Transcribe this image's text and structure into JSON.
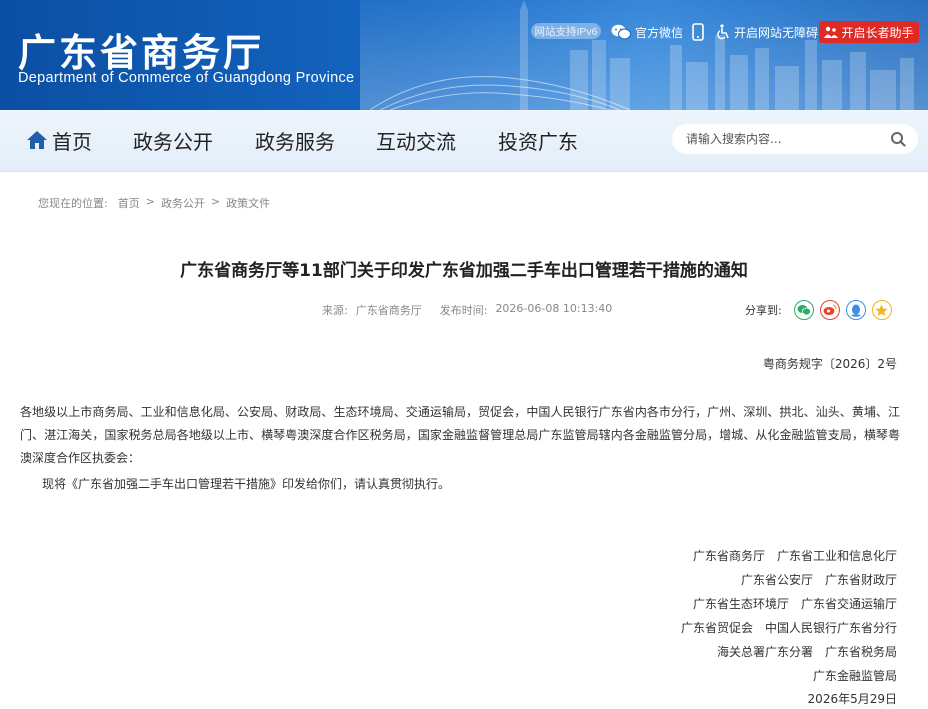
{
  "header": {
    "title": "广东省商务厅",
    "subtitle": "Department of Commerce of Guangdong Province",
    "ipv6": "网站支持IPv6",
    "wechat": "官方微信",
    "accessibility": "开启网站无障碍",
    "elder": "开启长者助手"
  },
  "nav": {
    "items": [
      "首页",
      "政务公开",
      "政务服务",
      "互动交流",
      "投资广东"
    ],
    "search_placeholder": "请输入搜索内容..."
  },
  "breadcrumb": {
    "prefix": "您现在的位置:",
    "items": [
      "首页",
      "政务公开",
      "政策文件"
    ],
    "separator": ">"
  },
  "article": {
    "title": "广东省商务厅等11部门关于印发广东省加强二手车出口管理若干措施的通知",
    "source_label": "来源:",
    "source": "广东省商务厅",
    "time_label": "发布时间:",
    "time": "2026-06-08 10:13:40",
    "share_label": "分享到:",
    "doc_number": "粤商务规字〔2026〕2号",
    "recipients": "各地级以上市商务局、工业和信息化局、公安局、财政局、生态环境局、交通运输局，贸促会，中国人民银行广东省内各市分行，广州、深圳、拱北、汕头、黄埔、江门、湛江海关，国家税务总局各地级以上市、横琴粤澳深度合作区税务局，国家金融监督管理总局广东监管局辖内各金融监管分局，增城、从化金融监管支局，横琴粤澳深度合作区执委会：",
    "paragraph": "现将《广东省加强二手车出口管理若干措施》印发给你们，请认真贯彻执行。",
    "signatures": [
      "广东省商务厅　广东省工业和信息化厅",
      "广东省公安厅　广东省财政厅",
      "广东省生态环境厅　广东省交通运输厅",
      "广东省贸促会　中国人民银行广东省分行",
      "海关总署广东分署　广东省税务局",
      "广东金融监管局",
      "2026年5月29日"
    ]
  },
  "colors": {
    "header_blue": "#1466c2",
    "elder_red": "#e02a26",
    "share_wechat": "#2aae67",
    "share_weibo": "#e6452e",
    "share_qq": "#3d8ee8",
    "share_qzone": "#f2b51b"
  }
}
